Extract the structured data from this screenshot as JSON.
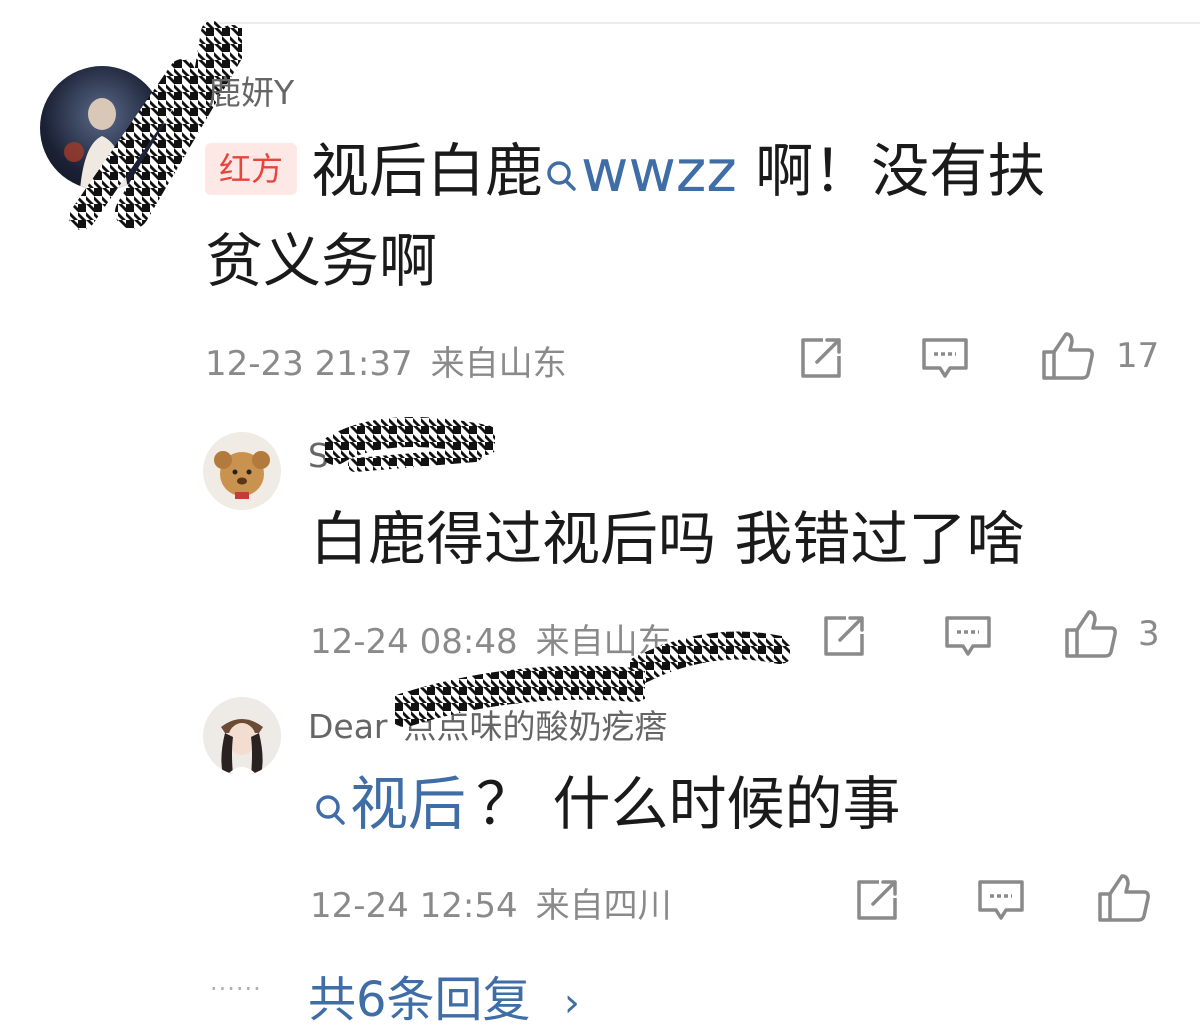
{
  "comments": [
    {
      "username": "鹿妍Y",
      "badge": "红方",
      "text_pre": "视后白鹿",
      "topic": "wwzz",
      "text_post_line1": " 啊！没有扶",
      "text_line2": "贫义务啊",
      "time": "12-23 21:37",
      "location": "来自山东",
      "likes": "17"
    }
  ],
  "replies": [
    {
      "username": "S",
      "text": "白鹿得过视后吗 我错过了啥",
      "time": "12-24 08:48",
      "location": "来自山东",
      "likes": "3"
    },
    {
      "username": "Dear",
      "username_tail": "点点味的酸奶疙瘩",
      "topic": "视后",
      "text": "？ 什么时候的事",
      "time": "12-24 12:54",
      "location": "来自四川",
      "likes": ""
    }
  ],
  "more_replies": {
    "dots": "······",
    "label": "共6条回复",
    "chevron": "›"
  },
  "icons": {
    "share": "share-icon",
    "comment": "comment-icon",
    "like": "thumbs-up-icon",
    "search": "search-icon"
  },
  "colors": {
    "link": "#3f6da5",
    "badge_bg": "#fde8e6",
    "badge_text": "#e5453a",
    "meta": "#8a8a8a"
  }
}
